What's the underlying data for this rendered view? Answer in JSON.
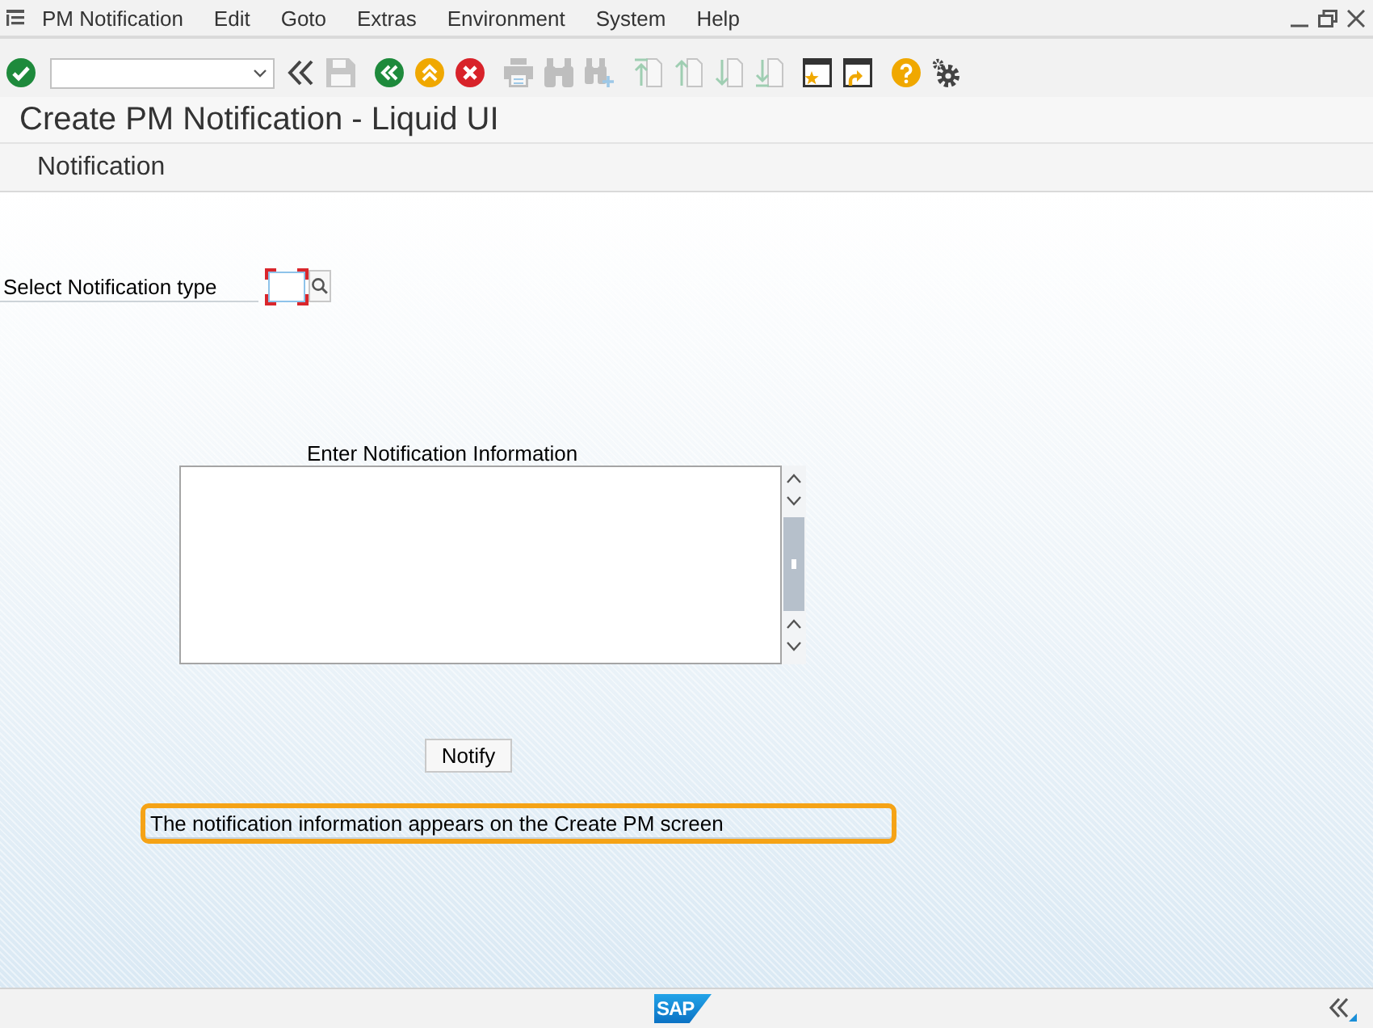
{
  "menu_bar": {
    "items": [
      "PM Notification",
      "Edit",
      "Goto",
      "Extras",
      "Environment",
      "System",
      "Help"
    ]
  },
  "toolbar": {
    "groups": [
      [
        {
          "kind": "enter",
          "disabled": false
        },
        {
          "kind": "command-field",
          "disabled": false
        },
        {
          "kind": "collapse",
          "disabled": false
        },
        {
          "kind": "save",
          "disabled": true
        }
      ],
      [
        {
          "kind": "back",
          "disabled": false
        },
        {
          "kind": "exit",
          "disabled": false
        },
        {
          "kind": "cancel",
          "disabled": false
        }
      ],
      [
        {
          "kind": "print",
          "disabled": true
        },
        {
          "kind": "find",
          "disabled": true
        },
        {
          "kind": "find-next",
          "disabled": true
        }
      ],
      [
        {
          "kind": "first-page",
          "disabled": true
        },
        {
          "kind": "previous-page",
          "disabled": true
        },
        {
          "kind": "next-page",
          "disabled": true
        },
        {
          "kind": "last-page",
          "disabled": true
        }
      ],
      [
        {
          "kind": "new-session",
          "disabled": false
        },
        {
          "kind": "shortcut",
          "disabled": false
        }
      ],
      [
        {
          "kind": "help",
          "disabled": false
        },
        {
          "kind": "customize",
          "disabled": false
        }
      ]
    ]
  },
  "title": "Create PM Notification - Liquid UI",
  "application_toolbar": {
    "buttons": [
      "Notification"
    ]
  },
  "form": {
    "notification_type": {
      "label": "Select Notification type",
      "required": true
    },
    "info_text": {
      "caption": "Enter Notification Information"
    },
    "notify_button": {
      "label": "Notify"
    },
    "message": {
      "value": "The notification information appears on the Create PM screen",
      "highlighted": true
    }
  },
  "status_bar": {
    "logo": "SAP"
  }
}
